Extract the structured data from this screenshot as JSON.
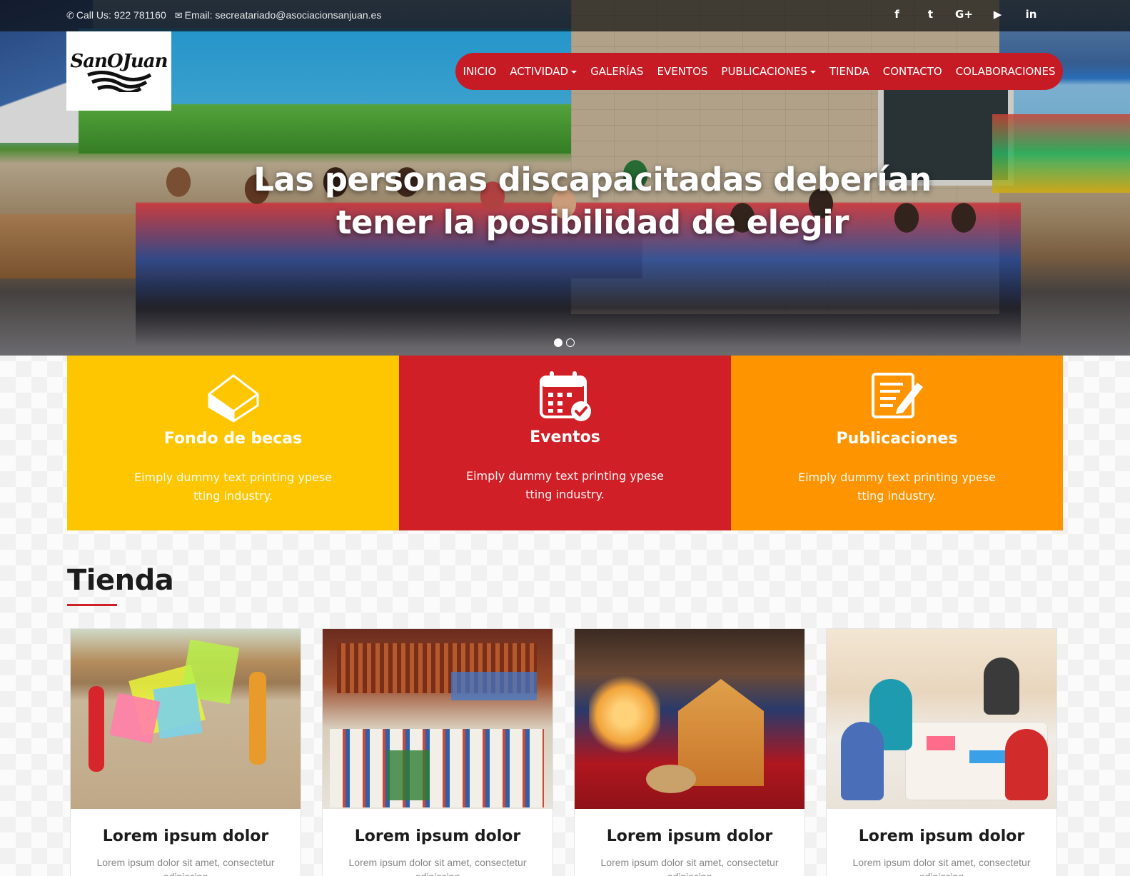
{
  "topbar": {
    "phone": "Call Us: 922 781160",
    "email": "Email: secreatariado@asociacionsanjuan.es",
    "social": [
      {
        "icon": "facebook-icon",
        "glyph": "f"
      },
      {
        "icon": "twitter-icon",
        "glyph": "t"
      },
      {
        "icon": "google-plus-icon",
        "glyph": "G+"
      },
      {
        "icon": "youtube-icon",
        "glyph": "▶"
      },
      {
        "icon": "linkedin-icon",
        "glyph": "in"
      }
    ]
  },
  "logo": {
    "text": "SanOJuan"
  },
  "nav": {
    "items": [
      {
        "label": "INICIO",
        "dropdown": false
      },
      {
        "label": "ACTIVIDAD",
        "dropdown": true
      },
      {
        "label": "GALERÍAS",
        "dropdown": false
      },
      {
        "label": "EVENTOS",
        "dropdown": false
      },
      {
        "label": "PUBLICACIONES",
        "dropdown": true
      },
      {
        "label": "TIENDA",
        "dropdown": false
      },
      {
        "label": "CONTACTO",
        "dropdown": false
      },
      {
        "label": "COLABORACIONES",
        "dropdown": false
      }
    ]
  },
  "hero": {
    "title_line1": "Las personas discapacitadas deberían",
    "title_line2": "tener la posibilidad de elegir",
    "slides": 2,
    "active_slide": 1
  },
  "features": [
    {
      "title": "Fondo de becas",
      "text": "Eimply dummy text printing ypese tting industry.",
      "color": "#fdc600",
      "icon": "house-icon"
    },
    {
      "title": "Eventos",
      "text": "Eimply dummy text printing ypese tting industry.",
      "color": "#d01f27",
      "icon": "calendar-check-icon"
    },
    {
      "title": "Publicaciones",
      "text": "Eimply dummy text printing ypese tting industry.",
      "color": "#fd9400",
      "icon": "edit-document-icon"
    }
  ],
  "shop": {
    "title": "Tienda",
    "products": [
      {
        "name": "Lorem ipsum dolor",
        "desc": "Lorem ipsum dolor sit amet, consectetur adipiscing"
      },
      {
        "name": "Lorem ipsum dolor",
        "desc": "Lorem ipsum dolor sit amet, consectetur adipiscing"
      },
      {
        "name": "Lorem ipsum dolor",
        "desc": "Lorem ipsum dolor sit amet, consectetur adipiscing"
      },
      {
        "name": "Lorem ipsum dolor",
        "desc": "Lorem ipsum dolor sit amet, consectetur adipiscing"
      }
    ]
  },
  "colors": {
    "brand_red": "#c61b24",
    "yellow": "#fdc600",
    "orange": "#fd9400"
  }
}
